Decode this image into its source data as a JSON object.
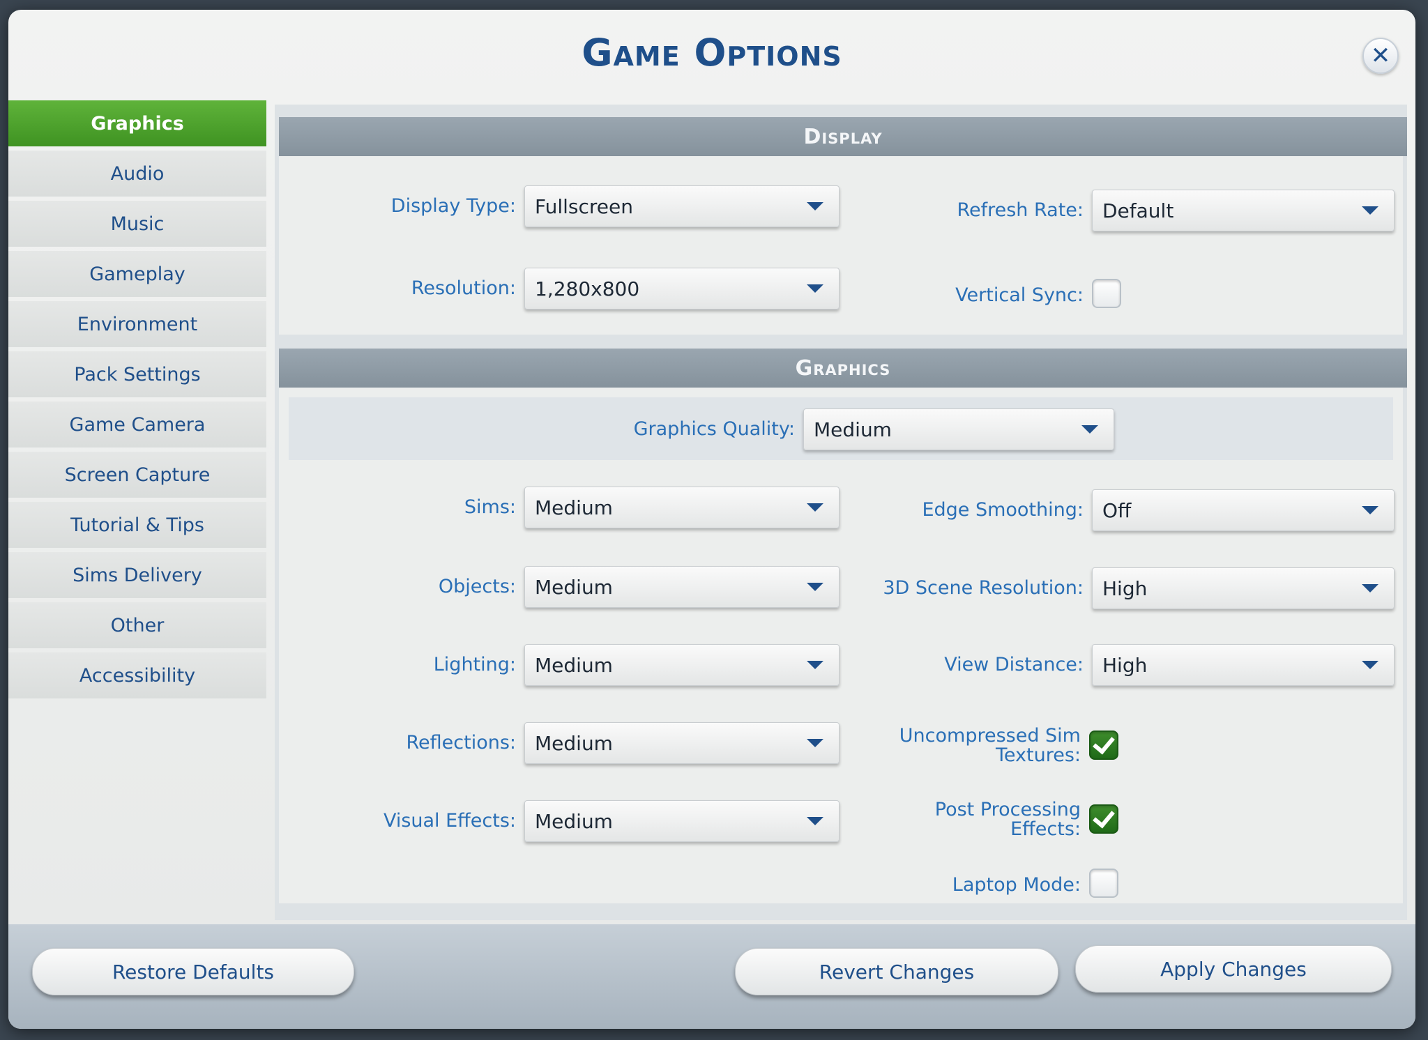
{
  "window": {
    "title": "Game Options"
  },
  "sidebar": {
    "items": [
      {
        "label": "Graphics",
        "active": true
      },
      {
        "label": "Audio"
      },
      {
        "label": "Music"
      },
      {
        "label": "Gameplay"
      },
      {
        "label": "Environment"
      },
      {
        "label": "Pack Settings"
      },
      {
        "label": "Game Camera"
      },
      {
        "label": "Screen Capture"
      },
      {
        "label": "Tutorial & Tips"
      },
      {
        "label": "Sims Delivery"
      },
      {
        "label": "Other"
      },
      {
        "label": "Accessibility"
      }
    ]
  },
  "display": {
    "header": "Display",
    "display_type": {
      "label": "Display Type:",
      "value": "Fullscreen"
    },
    "resolution": {
      "label": "Resolution:",
      "value": "1,280x800"
    },
    "refresh_rate": {
      "label": "Refresh Rate:",
      "value": "Default"
    },
    "vertical_sync": {
      "label": "Vertical Sync:",
      "checked": false
    }
  },
  "graphics": {
    "header": "Graphics",
    "graphics_quality": {
      "label": "Graphics Quality:",
      "value": "Medium"
    },
    "sims": {
      "label": "Sims:",
      "value": "Medium"
    },
    "objects": {
      "label": "Objects:",
      "value": "Medium"
    },
    "lighting": {
      "label": "Lighting:",
      "value": "Medium"
    },
    "reflections": {
      "label": "Reflections:",
      "value": "Medium"
    },
    "visual_effects": {
      "label": "Visual Effects:",
      "value": "Medium"
    },
    "edge_smoothing": {
      "label": "Edge Smoothing:",
      "value": "Off"
    },
    "scene_resolution": {
      "label": "3D Scene Resolution:",
      "value": "High"
    },
    "view_distance": {
      "label": "View Distance:",
      "value": "High"
    },
    "uncompressed_textures": {
      "label_line1": "Uncompressed Sim",
      "label_line2": "Textures:",
      "checked": true
    },
    "post_processing": {
      "label_line1": "Post Processing",
      "label_line2": "Effects:",
      "checked": true
    },
    "laptop_mode": {
      "label": "Laptop Mode:",
      "checked": false
    }
  },
  "footer": {
    "restore_defaults": "Restore Defaults",
    "revert_changes": "Revert Changes",
    "apply_changes": "Apply Changes"
  },
  "colors": {
    "accent_green": "#4ea82e",
    "label_blue": "#2a6fb6",
    "title_blue": "#1f4f8a",
    "section_header_gray": "#8f9ca6"
  }
}
